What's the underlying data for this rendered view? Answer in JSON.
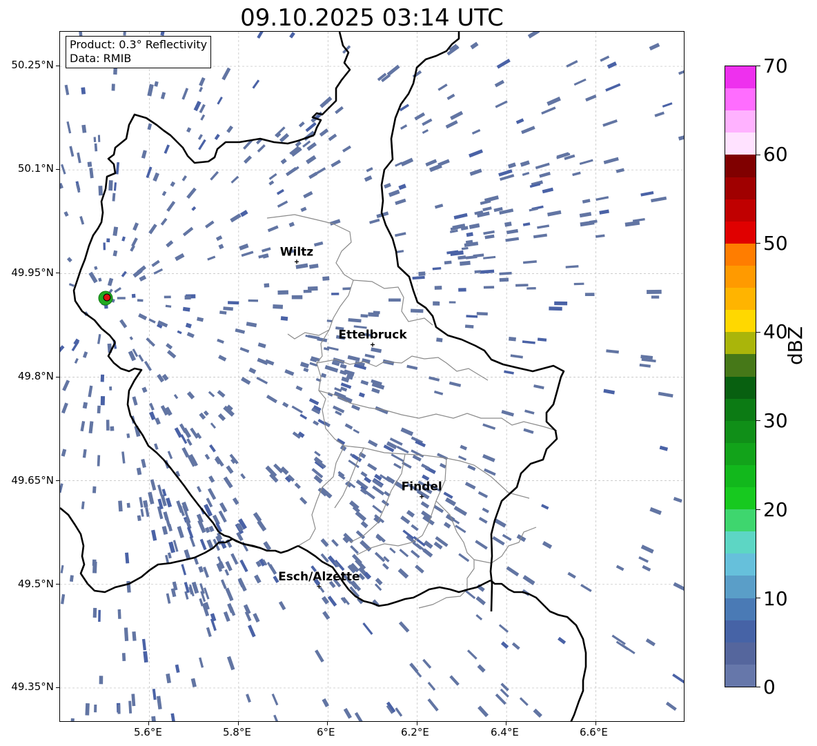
{
  "title": "09.10.2025 03:14 UTC",
  "info_box": {
    "product": "Product: 0.3° Reflectivity",
    "data": "Data: RMIB"
  },
  "lat_labels": [
    "50.25°N",
    "50.1°N",
    "49.95°N",
    "49.8°N",
    "49.65°N",
    "49.5°N",
    "49.35°N"
  ],
  "lon_labels": [
    "5.6°E",
    "5.8°E",
    "6°E",
    "6.2°E",
    "6.4°E",
    "6.6°E"
  ],
  "cities": [
    {
      "name": "Wiltz",
      "lon": 5.93,
      "lat": 49.967
    },
    {
      "name": "Ettelbruck",
      "lon": 6.1,
      "lat": 49.847
    },
    {
      "name": "Findel",
      "lon": 6.21,
      "lat": 49.627
    },
    {
      "name": "Esch/Alzette",
      "lon": 5.98,
      "lat": 49.497
    }
  ],
  "radar_site": {
    "lon": 5.505,
    "lat": 49.914
  },
  "map_extent": {
    "lon": [
      5.4,
      6.8
    ],
    "lat": [
      49.3,
      50.3
    ]
  },
  "colorbar": {
    "label": "dBZ",
    "tick_labels": [
      "0",
      "10",
      "20",
      "30",
      "40",
      "50",
      "60",
      "70"
    ],
    "colors": [
      "#6677aa",
      "#55669d",
      "#4663a6",
      "#4a7ab5",
      "#5a9ec8",
      "#66c0db",
      "#5dd6c4",
      "#3ed66e",
      "#17c91f",
      "#12b81c",
      "#12a31a",
      "#108f18",
      "#0c7b14",
      "#086010",
      "#467818",
      "#aab50a",
      "#ffd800",
      "#ffb400",
      "#ff9a00",
      "#ff7d00",
      "#e00000",
      "#c00000",
      "#a00000",
      "#800000",
      "#ffe2ff",
      "#ffb2ff",
      "#ff6dff",
      "#ee30ee"
    ]
  },
  "colors": {
    "echo": "#6275a3",
    "echo_dense": "#4a62a6",
    "border": "#000000",
    "admin": "#8a8a8a",
    "grid": "#bbbbbb",
    "site_fill": "#dd1111",
    "site_ring": "#22aa22"
  }
}
